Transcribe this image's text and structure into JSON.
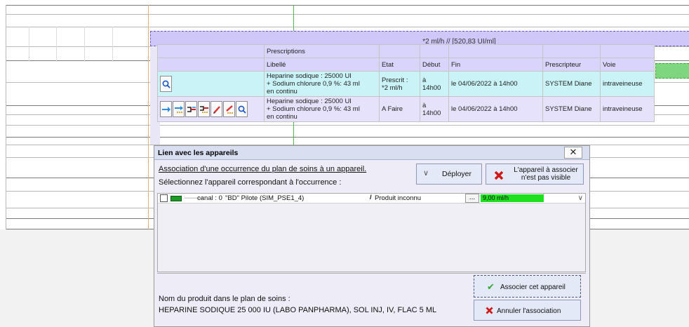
{
  "timeline": {
    "infusion_label": "*2 ml/h // [520,83 UI/ml]",
    "colors": {
      "infusion": "#cfc7f7",
      "green": "#7ed67e"
    }
  },
  "prescriptions": {
    "section_title": "Prescriptions",
    "headers": [
      "Libellé",
      "Etat",
      "Début",
      "Fin",
      "Prescripteur",
      "Voie"
    ],
    "rows": [
      {
        "libelle": [
          "Heparine sodique : 25000 UI",
          "+ Sodium chlorure 0,9 %: 43 ml",
          "en continu"
        ],
        "etat": [
          "Prescrit :",
          "*2 ml/h"
        ],
        "debut": "à 14h00",
        "fin": "le 04/06/2022 à 14h00",
        "prescripteur": "SYSTEM Diane",
        "voie": "intraveineuse",
        "icons": [
          "search-icon"
        ]
      },
      {
        "libelle": [
          "Heparine sodique : 25000 UI",
          "+ Sodium chlorure 0,9 %: 43 ml",
          "en continu"
        ],
        "etat": [
          "A Faire"
        ],
        "debut": "à 14h00",
        "fin": "le 04/06/2022 à 14h00",
        "prescripteur": "SYSTEM Diane",
        "voie": "intraveineuse",
        "icons": [
          "arrow-right-icon",
          "arrow-dots-icon",
          "connect-icon",
          "connect-dots-icon",
          "pencil-icon",
          "pencil-dots-icon",
          "search-icon"
        ]
      }
    ]
  },
  "dialog": {
    "title": "Lien avec les appareils",
    "close_label": "✕",
    "assoc_title": "Association d'une occurrence du plan de soins à un appareil.",
    "select_label": "Sélectionnez l'appareil correspondant à l'occurrence :",
    "deploy_label": "Déployer",
    "not_visible_label": "L'appareil à associer n'est pas visible",
    "device": {
      "canal": "canal : 0",
      "pilot": "\"BD\" Pilote (SIM_PSE1_4)",
      "product": "Produit inconnu",
      "more": "...",
      "rate": "9,00 ml/h"
    },
    "product_label": "Nom du produit dans le plan de soins :",
    "product_name": "HEPARINE SODIQUE 25 000 IU (LABO PANPHARMA), SOL INJ, IV, FLAC 5 ML",
    "associate_label": "Associer cet appareil",
    "cancel_label": "Annuler l'association"
  }
}
